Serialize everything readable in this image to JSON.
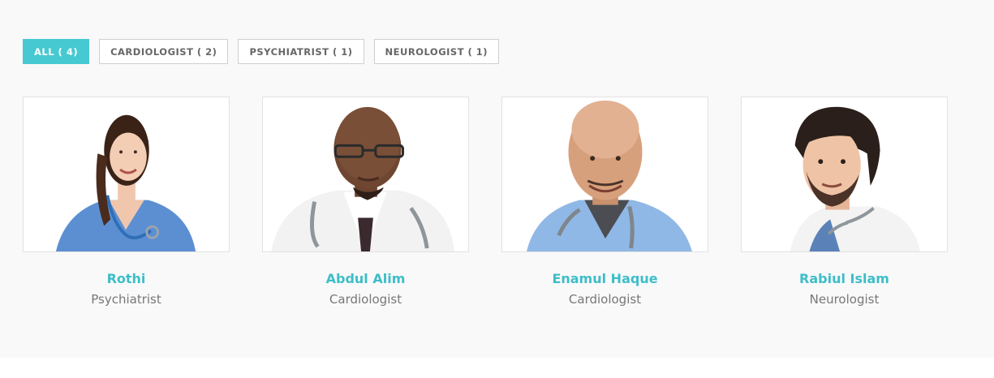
{
  "filters": [
    {
      "label": "ALL ( 4)",
      "active": true
    },
    {
      "label": "CARDIOLOGIST ( 2)",
      "active": false
    },
    {
      "label": "PSYCHIATRIST ( 1)",
      "active": false
    },
    {
      "label": "NEUROLOGIST ( 1)",
      "active": false
    }
  ],
  "doctors": [
    {
      "name": "Rothi",
      "specialty": "Psychiatrist"
    },
    {
      "name": "Abdul Alim",
      "specialty": "Cardiologist"
    },
    {
      "name": "Enamul Haque",
      "specialty": "Cardiologist"
    },
    {
      "name": "Rabiul Islam",
      "specialty": "Neurologist"
    }
  ],
  "colors": {
    "accent": "#47c9d1",
    "name": "#3dbec8",
    "section_bg": "#f9f9f9"
  }
}
